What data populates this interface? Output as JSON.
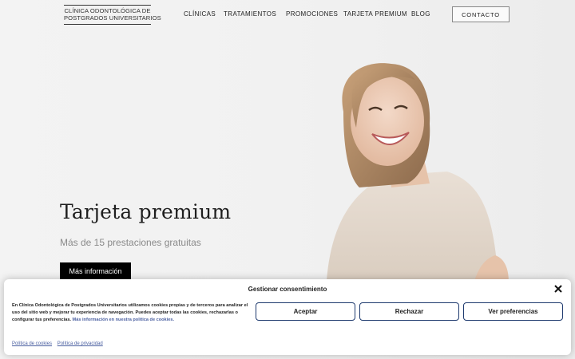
{
  "header": {
    "logo_line1": "CLÍNICA ODONTOLÓGICA DE",
    "logo_line2": "POSTGRADOS UNIVERSITARIOS",
    "nav": [
      {
        "label": "CLÍNICAS"
      },
      {
        "label": "TRATAMIENTOS"
      },
      {
        "label": "PROMOCIONES"
      },
      {
        "label": "TARJETA PREMIUM"
      },
      {
        "label": "BLOG"
      }
    ],
    "contact_label": "CONTACTO"
  },
  "hero": {
    "title": "Tarjeta premium",
    "subtitle": "Más de 15 prestaciones gratuitas",
    "button_label": "Más información"
  },
  "cookie_banner": {
    "title": "Gestionar consentimiento",
    "text": "En Clínica Odontológica de Postgrados Universitarios utilizamos cookies propias y de terceros para analizar el uso del sitio web y mejorar tu experiencia de navegación. Puedes aceptar todas las cookies, rechazarlas o configurar tus preferencias.",
    "more_link": "Más información en nuestra política de cookies.",
    "accept_label": "Aceptar",
    "reject_label": "Rechazar",
    "preferences_label": "Ver preferencias",
    "links": [
      "Política de cookies",
      "Política de privacidad"
    ]
  },
  "colors": {
    "primary_button": "#000000",
    "link": "#4a5fa0",
    "cookie_button_border": "#1e3a6e"
  }
}
